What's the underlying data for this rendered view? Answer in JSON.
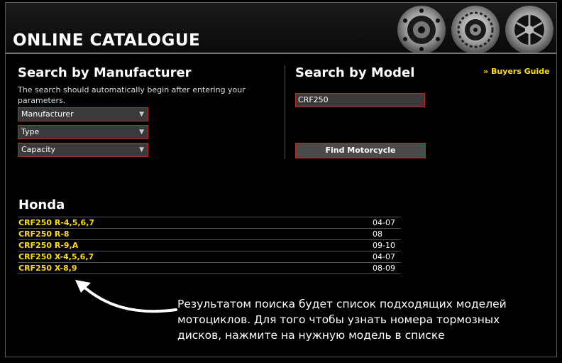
{
  "header": {
    "title": "ONLINE CATALOGUE"
  },
  "manufacturer_search": {
    "heading": "Search by Manufacturer",
    "description": "The search should automatically begin after entering your parameters.",
    "selects": [
      {
        "value": "Manufacturer"
      },
      {
        "value": "Type"
      },
      {
        "value": "Capacity"
      }
    ]
  },
  "model_search": {
    "heading": "Search by Model",
    "input_value": "CRF250",
    "button_label": "Find Motorcycle"
  },
  "buyers_guide": {
    "prefix": "»",
    "label": "Buyers Guide"
  },
  "results": {
    "heading": "Honda",
    "rows": [
      {
        "model": "CRF250 R-4,5,6,7",
        "years": "04-07"
      },
      {
        "model": "CRF250 R-8",
        "years": "08"
      },
      {
        "model": "CRF250 R-9,A",
        "years": "09-10"
      },
      {
        "model": "CRF250 X-4,5,6,7",
        "years": "04-07"
      },
      {
        "model": "CRF250 X-8,9",
        "years": "08-09"
      }
    ]
  },
  "annotation": {
    "text": "Результатом поиска будет список подходящих моделей мотоциклов. Для того чтобы узнать номера тормозных дисков, нажмите на нужную модель в списке"
  },
  "colors": {
    "accent_red": "#c4281c",
    "link_yellow": "#ffde00"
  }
}
